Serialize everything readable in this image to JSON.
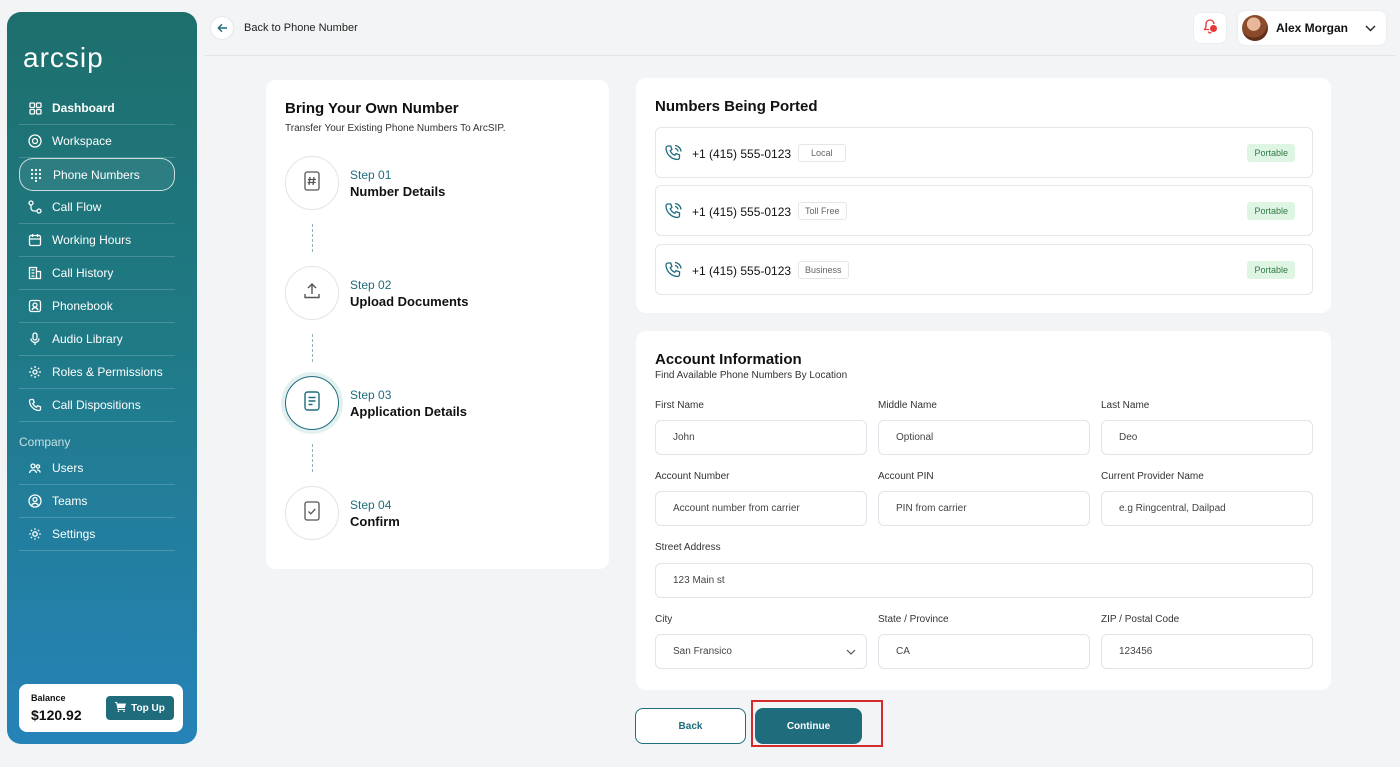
{
  "app": {
    "logo_text": "arcsip"
  },
  "sidebar": {
    "items": [
      {
        "label": "Dashboard"
      },
      {
        "label": "Workspace"
      },
      {
        "label": "Phone Numbers"
      },
      {
        "label": "Call Flow"
      },
      {
        "label": "Working Hours"
      },
      {
        "label": "Call History"
      },
      {
        "label": "Phonebook"
      },
      {
        "label": "Audio Library"
      },
      {
        "label": "Roles & Permissions"
      },
      {
        "label": "Call Dispositions"
      }
    ],
    "company_section": "Company",
    "company_items": [
      {
        "label": "Users"
      },
      {
        "label": "Teams"
      },
      {
        "label": "Settings"
      }
    ],
    "balance": {
      "label": "Balance",
      "amount": "$120.92",
      "topup_label": "Top Up"
    }
  },
  "header": {
    "back_label": "Back to Phone Number",
    "user_name": "Alex Morgan"
  },
  "steps": {
    "title": "Bring Your Own Number",
    "subtitle": "Transfer Your Existing Phone Numbers To ArcSIP.",
    "items": [
      {
        "step": "Step 01",
        "name": "Number Details"
      },
      {
        "step": "Step 02",
        "name": "Upload Documents"
      },
      {
        "step": "Step 03",
        "name": "Application Details"
      },
      {
        "step": "Step 04",
        "name": "Confirm"
      }
    ]
  },
  "numbers": {
    "title": "Numbers Being Ported",
    "rows": [
      {
        "number": "+1 (415) 555-0123",
        "type": "Local",
        "status": "Portable"
      },
      {
        "number": "+1 (415) 555-0123",
        "type": "Toll Free",
        "status": "Portable"
      },
      {
        "number": "+1 (415) 555-0123",
        "type": "Business",
        "status": "Portable"
      }
    ]
  },
  "account": {
    "title": "Account Information",
    "subtitle": "Find Available Phone Numbers By Location",
    "first_name": {
      "label": "First Name",
      "value": "John"
    },
    "middle_name": {
      "label": "Middle Name",
      "placeholder": "Optional"
    },
    "last_name": {
      "label": "Last Name",
      "value": "Deo"
    },
    "account_number": {
      "label": "Account Number",
      "placeholder": "Account number from carrier"
    },
    "account_pin": {
      "label": "Account PIN",
      "placeholder": "PIN from carrier"
    },
    "provider": {
      "label": "Current Provider Name",
      "placeholder": "e.g Ringcentral, Dailpad"
    },
    "street": {
      "label": "Street Address",
      "value": "123 Main st"
    },
    "city": {
      "label": "City",
      "value": "San Fransico"
    },
    "state": {
      "label": "State / Province",
      "value": "CA"
    },
    "zip": {
      "label": "ZIP / Postal Code",
      "value": "123456"
    }
  },
  "actions": {
    "back_label": "Back",
    "continue_label": "Continue"
  },
  "colors": {
    "accent": "#1f6c7c",
    "portable_bg": "#dff5e4",
    "notification": "#e53935",
    "highlight": "#d42a2a"
  }
}
